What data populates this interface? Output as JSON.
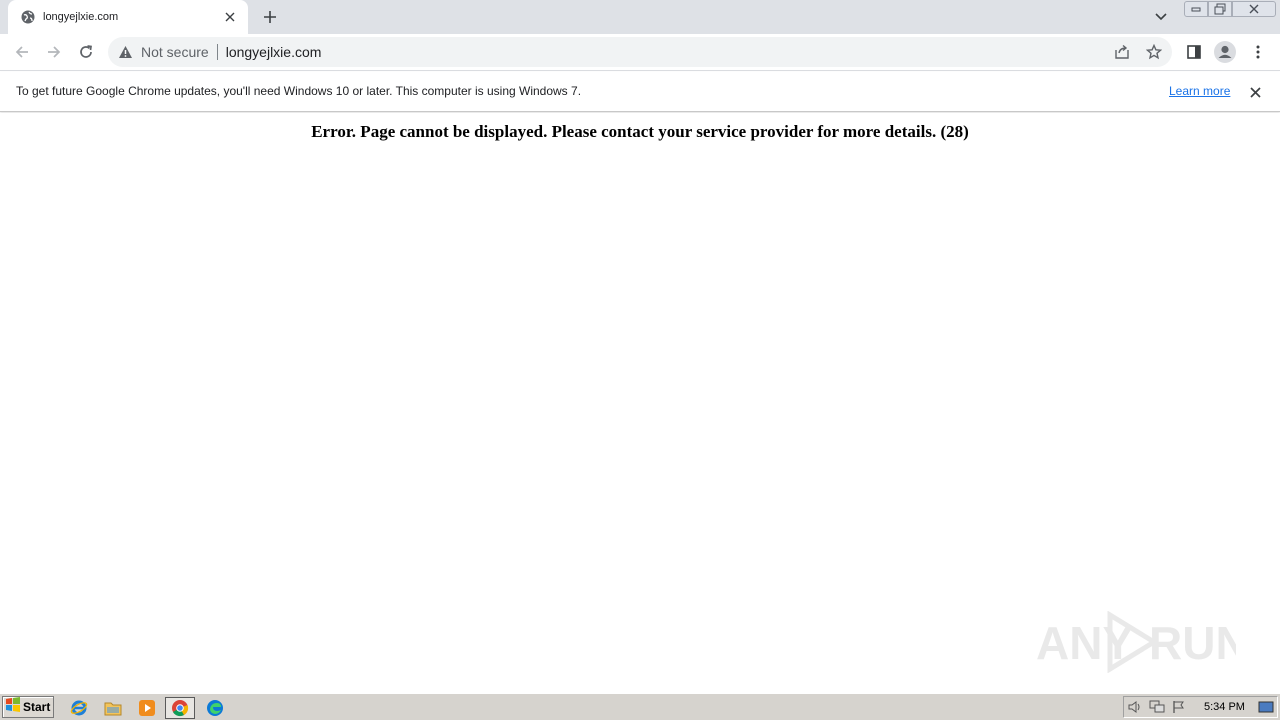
{
  "tab": {
    "title": "longyejlxie.com"
  },
  "omnibox": {
    "security_label": "Not secure",
    "url": "longyejlxie.com"
  },
  "infobar": {
    "message": "To get future Google Chrome updates, you'll need Windows 10 or later. This computer is using Windows 7.",
    "link_label": "Learn more"
  },
  "page": {
    "error_message": "Error. Page cannot be displayed. Please contact your service provider for more details. (28)"
  },
  "watermark": {
    "text_left": "ANY",
    "text_right": "RUN"
  },
  "taskbar": {
    "start_label": "Start",
    "clock": "5:34 PM",
    "quick_launch": [
      "internet-explorer-icon",
      "folder-icon",
      "media-player-icon",
      "chrome-icon",
      "edge-icon"
    ]
  },
  "colors": {
    "tabstrip_bg": "#dee1e6",
    "link": "#1a73e8",
    "taskbar_bg": "#d6d3ce"
  }
}
